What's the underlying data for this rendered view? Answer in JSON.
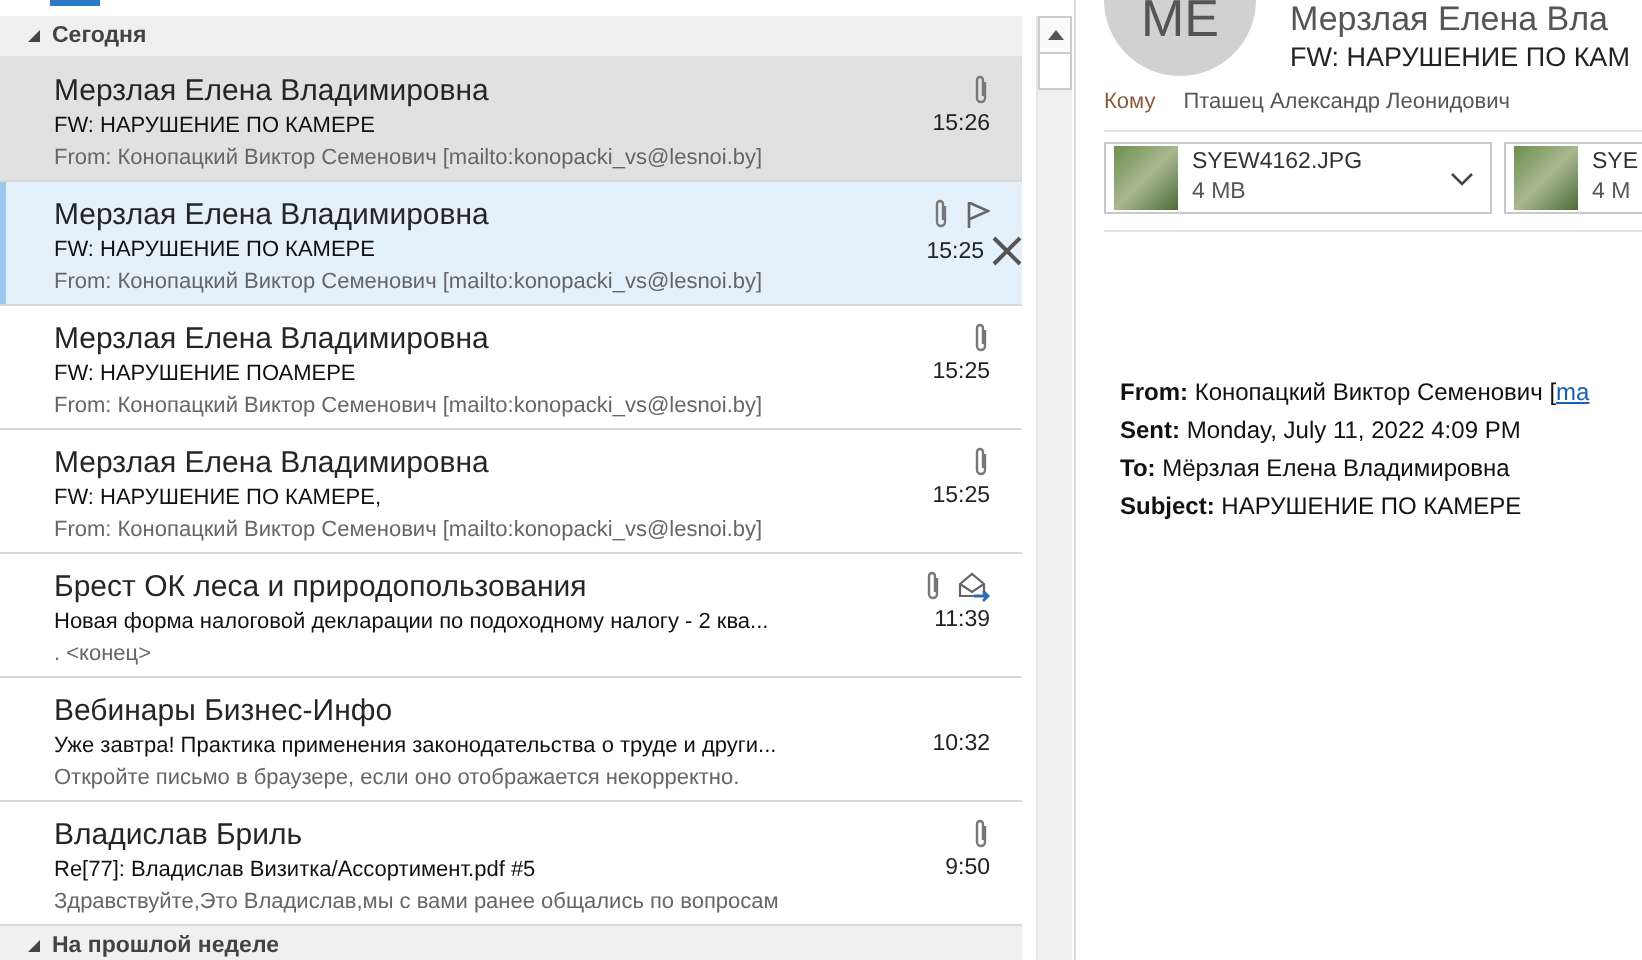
{
  "groups": [
    {
      "label": "Сегодня",
      "expanded": true,
      "messages": [
        {
          "sender": "Мерзлая Елена Владимировна",
          "subject": "FW: НАРУШЕНИЕ ПО КАМЕРЕ",
          "preview": "From: Конопацкий Виктор Семенович [mailto:konopacki_vs@lesnoi.by]",
          "time": "15:26",
          "attachment": true,
          "flag": false,
          "forwarded": false,
          "selected": true,
          "highlighted": false
        },
        {
          "sender": "Мерзлая Елена Владимировна",
          "subject": "FW: НАРУШЕНИЕ ПО КАМЕРЕ",
          "preview": "From: Конопацкий Виктор Семенович [mailto:konopacki_vs@lesnoi.by]",
          "time": "15:25",
          "attachment": true,
          "flag": true,
          "forwarded": false,
          "selected": false,
          "highlighted": true
        },
        {
          "sender": "Мерзлая Елена Владимировна",
          "subject": "FW: НАРУШЕНИЕ ПОАМЕРЕ",
          "preview": "From: Конопацкий Виктор Семенович [mailto:konopacki_vs@lesnoi.by]",
          "time": "15:25",
          "attachment": true,
          "flag": false,
          "forwarded": false,
          "selected": false,
          "highlighted": false
        },
        {
          "sender": "Мерзлая Елена Владимировна",
          "subject": "FW: НАРУШЕНИЕ ПО КАМЕРЕ,",
          "preview": "From: Конопацкий Виктор Семенович [mailto:konopacki_vs@lesnoi.by]",
          "time": "15:25",
          "attachment": true,
          "flag": false,
          "forwarded": false,
          "selected": false,
          "highlighted": false
        },
        {
          "sender": "Брест ОК леса  и природопользования",
          "subject": "Новая форма налоговой декларации по подоходному налогу - 2 ква...",
          "preview": ". <конец>",
          "time": "11:39",
          "attachment": true,
          "flag": false,
          "forwarded": true,
          "selected": false,
          "highlighted": false
        },
        {
          "sender": "Вебинары Бизнес-Инфо",
          "subject": "Уже завтра! Практика применения законодательства о труде и други...",
          "preview": "Откройте письмо в браузере, если оно отображается некорректно.",
          "time": "10:32",
          "attachment": false,
          "flag": false,
          "forwarded": false,
          "selected": false,
          "highlighted": false
        },
        {
          "sender": "Владислав Бриль",
          "subject": "Re[77]: Владислав Визитка/Ассортимент.pdf #5",
          "preview": "Здравствуйте,Это Владислав,мы с вами ранее общались по вопросам",
          "time": "9:50",
          "attachment": true,
          "flag": false,
          "forwarded": false,
          "selected": false,
          "highlighted": false
        }
      ]
    },
    {
      "label": "На прошлой неделе",
      "expanded": true
    }
  ],
  "reading_pane": {
    "avatar": "ME",
    "sender": "Мерзлая Елена Вла",
    "subject": "FW: НАРУШЕНИЕ ПО КАМ",
    "to_label": "Кому",
    "to": "Пташец Александр Леонидович",
    "attachments": [
      {
        "name": "SYEW4162.JPG",
        "size": "4 MB"
      },
      {
        "name": "SYE",
        "size": "4 M"
      }
    ],
    "header_lines": [
      {
        "label": "From:",
        "value": "Конопацкий Виктор Семенович [",
        "link": "ma"
      },
      {
        "label": "Sent:",
        "value": "Monday, July 11, 2022 4:09 PM"
      },
      {
        "label": "To:",
        "value": "Мёрзлая Елена Владимировна"
      },
      {
        "label": "Subject:",
        "value": "НАРУШЕНИЕ ПО КАМЕРЕ"
      }
    ]
  }
}
